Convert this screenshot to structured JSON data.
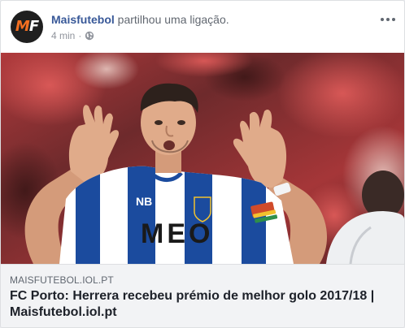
{
  "post": {
    "avatar_letters": "MF",
    "page_name": "Maisfutebol",
    "action": " partilhou uma ligação.",
    "time": "4 min",
    "separator": "·",
    "privacy_icon": "globe-icon",
    "more_icon": "more-options-icon"
  },
  "link": {
    "domain": "MAISFUTEBOL.IOL.PT",
    "title": "FC Porto: Herrera recebeu prémio de melhor golo 2017/18 | Maisfutebol.iol.pt"
  },
  "colors": {
    "page_name": "#385898",
    "jersey_blue": "#1b4b9e",
    "jersey_white": "#ffffff",
    "brand_orange": "#f36f21"
  },
  "photo": {
    "subject": "footballer-celebrating",
    "jersey_text": "MEO",
    "sleeve_text": "NB"
  }
}
